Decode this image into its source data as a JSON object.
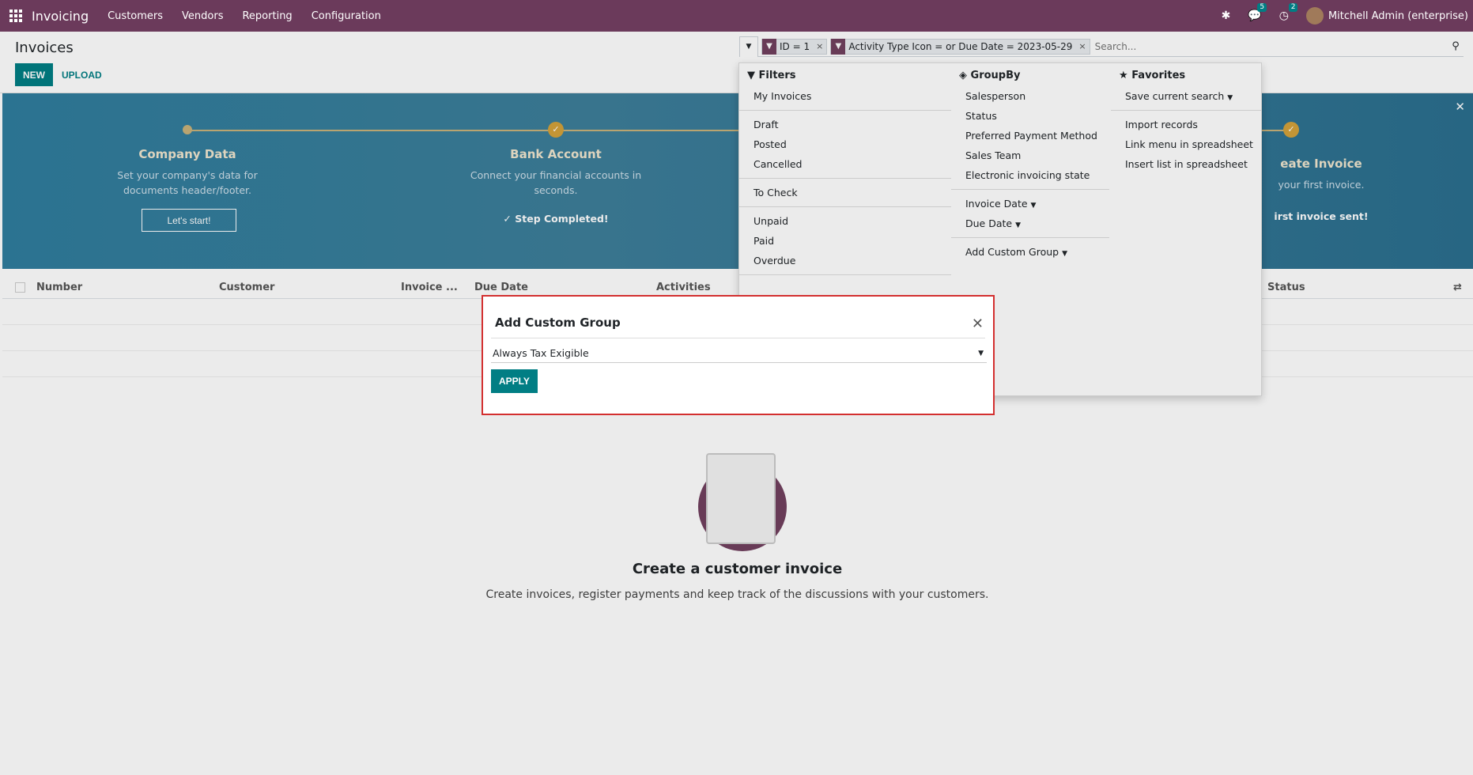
{
  "navbar": {
    "app_name": "Invoicing",
    "menus": [
      "Customers",
      "Vendors",
      "Reporting",
      "Configuration"
    ],
    "messages_badge": "5",
    "activities_badge": "2",
    "user": "Mitchell Admin (enterprise)"
  },
  "control_panel": {
    "title": "Invoices",
    "new_label": "NEW",
    "upload_label": "UPLOAD"
  },
  "search": {
    "facets": [
      {
        "text": "ID = 1"
      },
      {
        "text": "Activity Type Icon = or Due Date = 2023-05-29"
      }
    ],
    "placeholder": "Search..."
  },
  "banner": {
    "steps": [
      {
        "title": "Company Data",
        "desc": "Set your company's data for documents header/footer.",
        "action": "Let's start!"
      },
      {
        "title": "Bank Account",
        "desc": "Connect your financial accounts in seconds.",
        "action": "Step Completed!"
      },
      {
        "title": "eate Invoice",
        "desc": "your first invoice.",
        "action": "irst invoice sent!"
      }
    ]
  },
  "list": {
    "columns": [
      "Number",
      "Customer",
      "Invoice ...",
      "Due Date",
      "Activities",
      "Status"
    ]
  },
  "empty": {
    "title": "Create a customer invoice",
    "text": "Create invoices, register payments and keep track of the discussions with your customers."
  },
  "dropdown": {
    "filters_title": "Filters",
    "filters_groups": [
      [
        "My Invoices"
      ],
      [
        "Draft",
        "Posted",
        "Cancelled"
      ],
      [
        "To Check"
      ],
      [
        "Unpaid",
        "Paid",
        "Overdue"
      ]
    ],
    "groupby_title": "GroupBy",
    "groupby_items": [
      "Salesperson",
      "Status",
      "Preferred Payment Method",
      "Sales Team",
      "Electronic invoicing state"
    ],
    "groupby_dates": [
      "Invoice Date",
      "Due Date"
    ],
    "add_custom_group": "Add Custom Group",
    "favorites_title": "Favorites",
    "save_current_search": "Save current search",
    "favorites_items": [
      "Import records",
      "Link menu in spreadsheet",
      "Insert list in spreadsheet"
    ]
  },
  "modal": {
    "title": "Add Custom Group",
    "selected": "Always Tax Exigible",
    "apply_label": "APPLY"
  }
}
